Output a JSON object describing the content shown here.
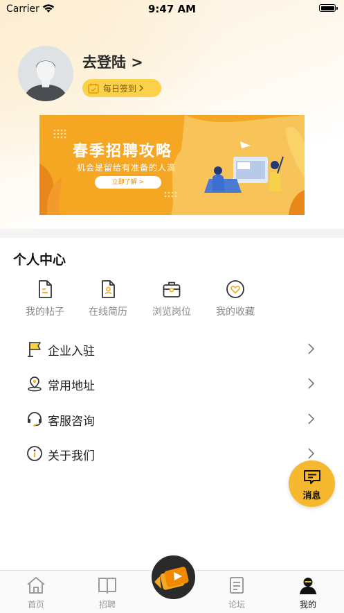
{
  "status_bar": {
    "carrier": "Carrier",
    "time": "9:47 AM"
  },
  "profile": {
    "login_label": "去登陆 >",
    "signin_label": "每日签到"
  },
  "banner": {
    "title": "春季招聘攻略",
    "subtitle": "机会是留给有准备的人滴",
    "button": "立即了解 >"
  },
  "personal_center": {
    "title": "个人中心",
    "grid": [
      {
        "label": "我的帖子",
        "icon": "document-icon"
      },
      {
        "label": "在线简历",
        "icon": "resume-icon"
      },
      {
        "label": "浏览岗位",
        "icon": "briefcase-icon"
      },
      {
        "label": "我的收藏",
        "icon": "heart-icon"
      }
    ],
    "list": [
      {
        "label": "企业入驻",
        "icon": "flag-icon"
      },
      {
        "label": "常用地址",
        "icon": "location-icon"
      },
      {
        "label": "客服咨询",
        "icon": "headset-icon"
      },
      {
        "label": "关于我们",
        "icon": "info-icon"
      }
    ]
  },
  "message_button": {
    "label": "消息"
  },
  "tabbar": {
    "tabs": [
      {
        "label": "首页",
        "icon": "home-icon"
      },
      {
        "label": "招聘",
        "icon": "book-icon"
      },
      {
        "label": "论坛",
        "icon": "forum-icon"
      },
      {
        "label": "我的",
        "icon": "user-icon"
      }
    ],
    "center_icon": "video-camera-icon"
  },
  "colors": {
    "accent": "#f5a623",
    "badge": "#fbd14b",
    "fab": "#f5b82e"
  }
}
